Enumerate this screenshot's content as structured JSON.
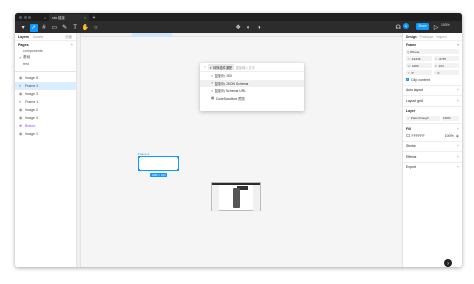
{
  "tabs": {
    "file_name": "stw 链接",
    "new_tab": "+"
  },
  "toolbar": {
    "share_label": "Share",
    "zoom": "100%",
    "avatar_initial": "A",
    "left_icons": [
      "menu-icon",
      "move-icon",
      "frame-icon",
      "shape-icon",
      "pen-icon",
      "text-icon",
      "hand-icon",
      "comment-icon"
    ],
    "center_icons": [
      "component-icon",
      "mask-icon",
      "contrast-icon"
    ]
  },
  "left_panel": {
    "tabs": [
      "Layers",
      "Assets"
    ],
    "page_dropdown": "页面",
    "pages_heading": "Pages",
    "pages": [
      "components",
      "基础",
      "test"
    ],
    "current_page_index": 1,
    "layers": [
      {
        "label": "Image 5",
        "icon": "image-icon",
        "type": "image"
      },
      {
        "label": "Frame 2",
        "icon": "frame-icon",
        "type": "frame",
        "selected": true
      },
      {
        "label": "Image 3",
        "icon": "image-icon",
        "type": "image"
      },
      {
        "label": "Frame 1",
        "icon": "frame-icon",
        "type": "frame"
      },
      {
        "label": "Image 2",
        "icon": "image-icon",
        "type": "image"
      },
      {
        "label": "Image 4",
        "icon": "image-icon",
        "type": "image"
      },
      {
        "label": "Button",
        "icon": "component-icon",
        "type": "component"
      },
      {
        "label": "Image 1",
        "icon": "image-icon",
        "type": "image"
      }
    ]
  },
  "canvas": {
    "frame_label": "Frame 2",
    "frame_size": "1080 × 164",
    "popup": {
      "chip": "转换插件通配",
      "placeholder": "直接输入文字",
      "items": [
        {
          "icon": "code-icon",
          "label": "复制为 JSX"
        },
        {
          "icon": "code-icon",
          "label": "复制为 JSON Schema",
          "highlighted": true
        },
        {
          "icon": "code-icon",
          "label": "复制为 Schema URL"
        },
        {
          "icon": "sandbox-icon",
          "label": "CodeSandbox 预览"
        }
      ]
    }
  },
  "right_panel": {
    "tabs": [
      "Design",
      "Prototype",
      "Inspect"
    ],
    "frame_heading": "Frame",
    "frame_type": "iPhone",
    "x": "-19446",
    "y": "-5787",
    "w": "1080",
    "h": "164",
    "rotation": "0°",
    "radius": "0",
    "clip_content": "Clip content",
    "sections": [
      "Auto layout",
      "Layout grid",
      "Layer"
    ],
    "layer_mode": "Pass through",
    "layer_opacity": "100%",
    "fill_heading": "Fill",
    "fill_hex": "FFFFFF",
    "fill_opacity": "100%",
    "fill_color": "#ffffff",
    "bottom_sections": [
      "Stroke",
      "Effects",
      "Export"
    ]
  },
  "help_label": "?"
}
